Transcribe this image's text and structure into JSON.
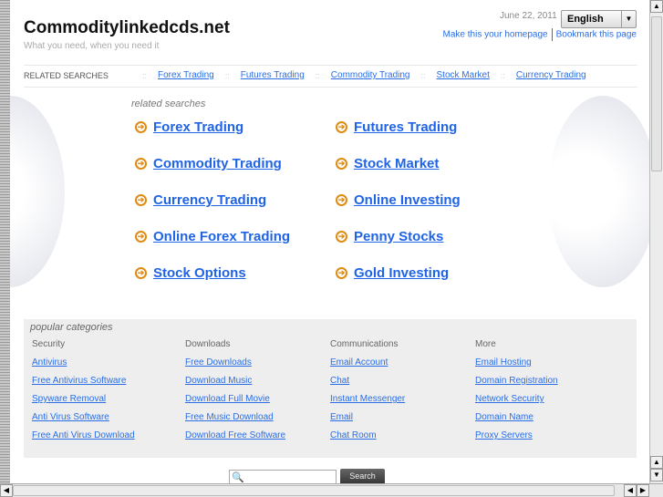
{
  "header": {
    "site_title": "Commoditylinkedcds.net",
    "tagline": "What you need, when you need it",
    "date": "June 22, 2011",
    "language": "English",
    "homepage_link": "Make this your homepage",
    "bookmark_link": "Bookmark this page"
  },
  "related_bar": {
    "label": "RELATED SEARCHES",
    "links": [
      "Forex Trading",
      "Futures Trading",
      "Commodity Trading",
      "Stock Market",
      "Currency Trading"
    ]
  },
  "related": {
    "heading": "related searches",
    "left": [
      "Forex Trading",
      "Commodity Trading",
      "Currency Trading",
      "Online Forex Trading",
      "Stock Options"
    ],
    "right": [
      "Futures Trading",
      "Stock Market",
      "Online Investing",
      "Penny Stocks",
      "Gold Investing"
    ]
  },
  "popular": {
    "heading": "popular categories",
    "columns": [
      {
        "title": "Security",
        "links": [
          "Antivirus",
          "Free Antivirus Software",
          "Spyware Removal",
          "Anti Virus Software",
          "Free Anti Virus Download"
        ]
      },
      {
        "title": "Downloads",
        "links": [
          "Free Downloads",
          "Download Music",
          "Download Full Movie",
          "Free Music Download",
          "Download Free Software"
        ]
      },
      {
        "title": "Communications",
        "links": [
          "Email Account",
          "Chat",
          "Instant Messenger",
          "Email",
          "Chat Room"
        ]
      },
      {
        "title": "More",
        "links": [
          "Email Hosting",
          "Domain Registration",
          "Network Security",
          "Domain Name",
          "Proxy Servers"
        ]
      }
    ]
  },
  "search": {
    "button": "Search",
    "value": ""
  }
}
